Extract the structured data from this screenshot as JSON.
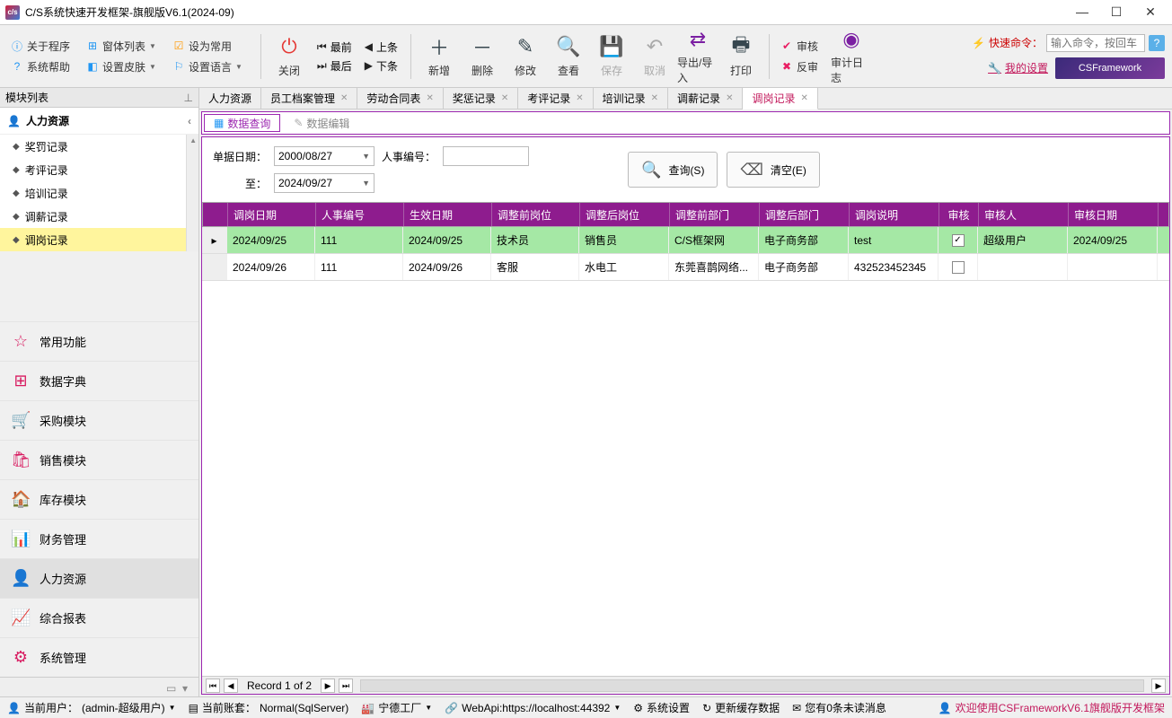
{
  "window": {
    "title": "C/S系统快速开发框架-旗舰版V6.1(2024-09)"
  },
  "toolbar": {
    "about": "关于程序",
    "formlist": "窗体列表",
    "setcommon": "设为常用",
    "help": "系统帮助",
    "skin": "设置皮肤",
    "lang": "设置语言",
    "close": "关闭",
    "first": "最前",
    "prev": "上条",
    "next": "下条",
    "last": "最后",
    "add": "新增",
    "delete": "删除",
    "edit": "修改",
    "view": "查看",
    "save": "保存",
    "cancel": "取消",
    "io": "导出/导入",
    "print": "打印",
    "audit": "审核",
    "unaudit": "反审",
    "auditlog": "审计日志",
    "cmd_label": "快速命令：",
    "cmd_placeholder": "输入命令，按回车",
    "mysettings": "我的设置",
    "brand": "CSFramework"
  },
  "sidebar": {
    "header": "模块列表",
    "module": "人力资源",
    "items": [
      "奖罚记录",
      "考评记录",
      "培训记录",
      "调薪记录",
      "调岗记录"
    ],
    "selected_index": 4,
    "nav": [
      "常用功能",
      "数据字典",
      "采购模块",
      "销售模块",
      "库存模块",
      "财务管理",
      "人力资源",
      "综合报表",
      "系统管理"
    ],
    "nav_active": 6
  },
  "tabs": {
    "items": [
      "人力资源",
      "员工档案管理",
      "劳动合同表",
      "奖惩记录",
      "考评记录",
      "培训记录",
      "调薪记录",
      "调岗记录"
    ],
    "active": 7
  },
  "subtabs": {
    "query": "数据查询",
    "edit": "数据编辑"
  },
  "filter": {
    "date_label": "单据日期：",
    "to_label": "至：",
    "date_from": "2000/08/27",
    "date_to": "2024/09/27",
    "emp_label": "人事编号：",
    "emp_value": "",
    "btn_query": "查询(S)",
    "btn_clear": "清空(E)"
  },
  "grid": {
    "columns": [
      "调岗日期",
      "人事编号",
      "生效日期",
      "调整前岗位",
      "调整后岗位",
      "调整前部门",
      "调整后部门",
      "调岗说明",
      "审核",
      "审核人",
      "审核日期"
    ],
    "rows": [
      {
        "cells": [
          "2024/09/25",
          "111",
          "2024/09/25",
          "技术员",
          "销售员",
          "C/S框架网",
          "电子商务部",
          "test"
        ],
        "checked": true,
        "auditor": "超级用户",
        "auditdate": "2024/09/25"
      },
      {
        "cells": [
          "2024/09/26",
          "111",
          "2024/09/26",
          "客服",
          "水电工",
          "东莞喜鹊网络...",
          "电子商务部",
          "432523452345"
        ],
        "checked": false,
        "auditor": "",
        "auditdate": ""
      }
    ],
    "record_text": "Record 1 of 2"
  },
  "statusbar": {
    "user_label": "当前用户：",
    "user": "(admin-超级用户)",
    "account_label": "当前账套：",
    "account": "Normal(SqlServer)",
    "factory": "宁德工厂",
    "webapi": "WebApi:https://localhost:44392",
    "syssettings": "系统设置",
    "refreshcache": "更新缓存数据",
    "msgs": "您有0条未读消息",
    "welcome": "欢迎使用CSFrameworkV6.1旗舰版开发框架"
  }
}
